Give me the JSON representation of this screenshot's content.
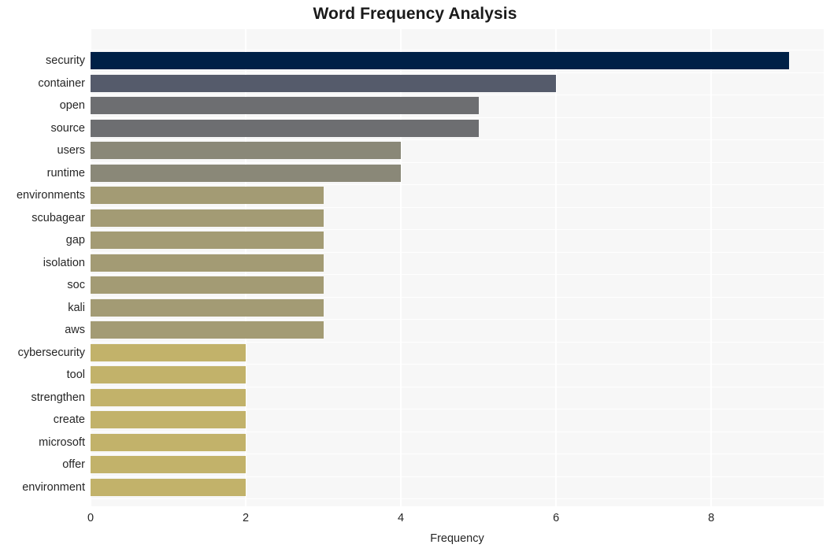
{
  "chart_data": {
    "type": "bar",
    "orientation": "horizontal",
    "title": "Word Frequency Analysis",
    "xlabel": "Frequency",
    "ylabel": "",
    "categories": [
      "security",
      "container",
      "open",
      "source",
      "users",
      "runtime",
      "environments",
      "scubagear",
      "gap",
      "isolation",
      "soc",
      "kali",
      "aws",
      "cybersecurity",
      "tool",
      "strengthen",
      "create",
      "microsoft",
      "offer",
      "environment"
    ],
    "values": [
      9,
      6,
      5,
      5,
      4,
      4,
      3,
      3,
      3,
      3,
      3,
      3,
      3,
      2,
      2,
      2,
      2,
      2,
      2,
      2
    ],
    "bar_colors": [
      "#002147",
      "#555b6b",
      "#6d6e71",
      "#6d6e71",
      "#8a8878",
      "#8a8878",
      "#a39b74",
      "#a39b74",
      "#a39b74",
      "#a39b74",
      "#a39b74",
      "#a39b74",
      "#a39b74",
      "#c2b26a",
      "#c2b26a",
      "#c2b26a",
      "#c2b26a",
      "#c2b26a",
      "#c2b26a",
      "#c2b26a"
    ],
    "xlim": [
      0,
      9.45
    ],
    "xticks": [
      0,
      2,
      4,
      6,
      8
    ],
    "xtick_labels": [
      "0",
      "2",
      "4",
      "6",
      "8"
    ],
    "grid": true,
    "grid_color": "#ffffff",
    "plot_background": "#f7f7f7",
    "figure_background": "#ffffff",
    "legend": null
  }
}
